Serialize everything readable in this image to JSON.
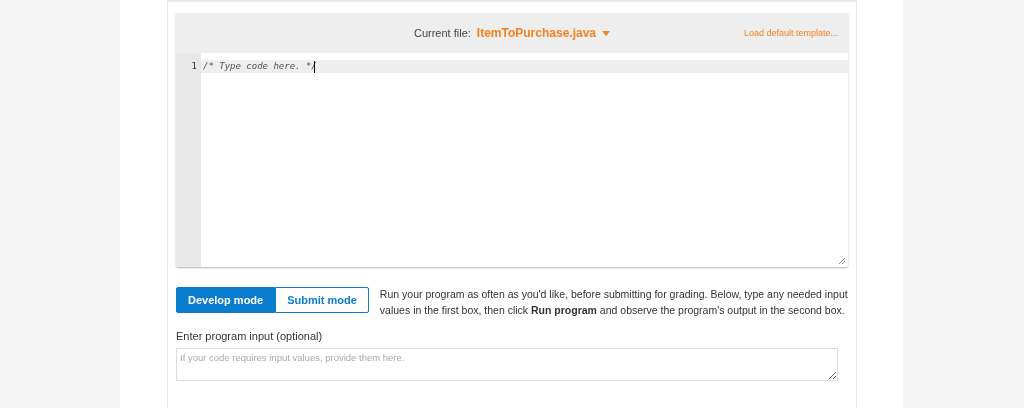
{
  "editor": {
    "file_label": "Current file:",
    "file_name": "ItemToPurchase.java",
    "load_template": "Load default template...",
    "lines": [
      {
        "number": "1",
        "code": "/* Type code here. */"
      }
    ]
  },
  "modes": [
    {
      "label": "Develop mode",
      "selected": true
    },
    {
      "label": "Submit mode",
      "selected": false
    }
  ],
  "instructions": "Run your program as often as you'd like, before submitting for grading. Below, type any needed input values in the first box, then click **Run program** and observe the program's output in the second box.",
  "input": {
    "label": "Enter program input (optional)",
    "placeholder": "If your code requires input values, provide them here."
  }
}
